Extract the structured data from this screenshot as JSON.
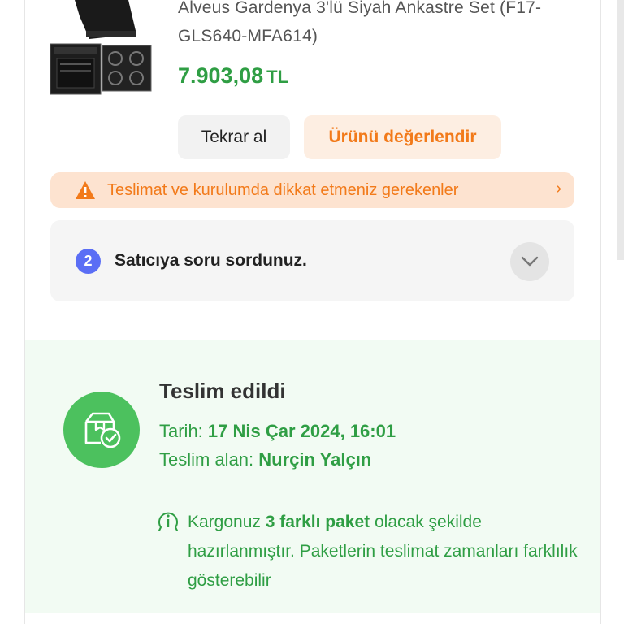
{
  "product": {
    "title": "Alveus Gardenya 3'lü Siyah Ankastre Set (F17-GLS640-MFA614)",
    "price_value": "7.903,08",
    "price_currency": "TL",
    "image_icon": "built-in-oven-hood-hob-set-image"
  },
  "actions": {
    "buy_again": "Tekrar al",
    "rate_product": "Ürünü değerlendir"
  },
  "warning": {
    "text": "Teslimat ve kurulumda dikkat etmeniz gerekenler",
    "icon": "warning-triangle-icon",
    "chevron": "›"
  },
  "question": {
    "count": "2",
    "text": "Satıcıya soru sordunuz.",
    "toggle_icon": "chevron-down-icon"
  },
  "delivery": {
    "title": "Teslim edildi",
    "date_label": "Tarih:",
    "date_value": "17 Nis Çar 2024, 16:01",
    "receiver_label": "Teslim alan:",
    "receiver_value": "Nurçin Yalçın",
    "info_prefix": "Kargonuz",
    "info_bold": "3 farklı paket",
    "info_suffix": "olacak şekilde hazırlanmıştır. Paketlerin teslimat zamanları farklılık gösterebilir",
    "icon": "package-check-icon"
  },
  "colors": {
    "accent_orange": "#f27a1a",
    "success_green": "#2f9e44",
    "badge_blue": "#5b6ef5"
  }
}
